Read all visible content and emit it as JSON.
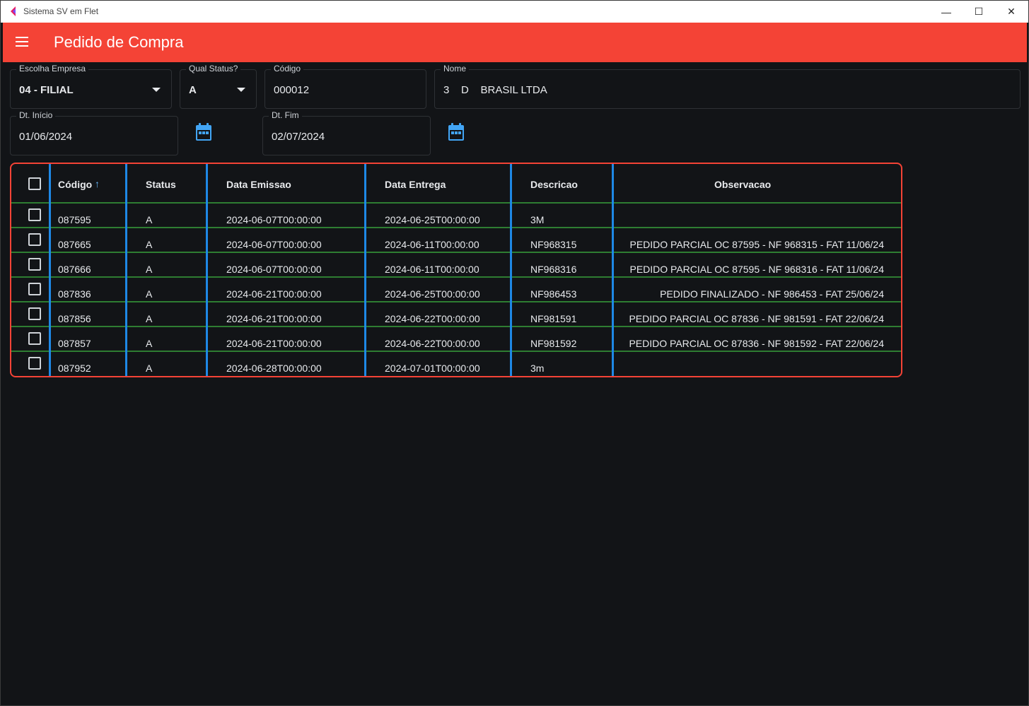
{
  "window": {
    "title": "Sistema SV em Flet",
    "minimize": "—",
    "maximize": "☐",
    "close": "✕"
  },
  "appbar": {
    "title": "Pedido de Compra",
    "icon": "menu-icon"
  },
  "filters": {
    "empresa": {
      "label": "Escolha Empresa",
      "value": "04 - FILIAL"
    },
    "status": {
      "label": "Qual Status?",
      "value": "A"
    },
    "codigo": {
      "label": "Código",
      "value": "000012"
    },
    "nome": {
      "label": "Nome",
      "value": "3    D    BRASIL LTDA"
    },
    "dt_inicio": {
      "label": "Dt. Início",
      "value": "01/06/2024"
    },
    "dt_fim": {
      "label": "Dt. Fim",
      "value": "02/07/2024"
    }
  },
  "colors": {
    "accent": "#f44336",
    "divider": "#1e88e5",
    "row_border": "#2e7d32",
    "calendar_icon": "#42a5f5"
  },
  "table": {
    "columns": [
      "Código",
      "Status",
      "Data Emissao",
      "Data Entrega",
      "Descricao",
      "Observacao"
    ],
    "sort_icon": "↑",
    "rows": [
      {
        "codigo": "087595",
        "status": "A",
        "emissao": "2024-06-07T00:00:00",
        "entrega": "2024-06-25T00:00:00",
        "descricao": "3M",
        "observacao": ""
      },
      {
        "codigo": "087665",
        "status": "A",
        "emissao": "2024-06-07T00:00:00",
        "entrega": "2024-06-11T00:00:00",
        "descricao": "NF968315",
        "observacao": "PEDIDO PARCIAL OC 87595 - NF 968315 - FAT 11/06/24"
      },
      {
        "codigo": "087666",
        "status": "A",
        "emissao": "2024-06-07T00:00:00",
        "entrega": "2024-06-11T00:00:00",
        "descricao": "NF968316",
        "observacao": "PEDIDO PARCIAL OC 87595 - NF 968316 - FAT 11/06/24"
      },
      {
        "codigo": "087836",
        "status": "A",
        "emissao": "2024-06-21T00:00:00",
        "entrega": "2024-06-25T00:00:00",
        "descricao": "NF986453",
        "observacao": "PEDIDO FINALIZADO - NF 986453 - FAT 25/06/24"
      },
      {
        "codigo": "087856",
        "status": "A",
        "emissao": "2024-06-21T00:00:00",
        "entrega": "2024-06-22T00:00:00",
        "descricao": "NF981591",
        "observacao": "PEDIDO PARCIAL OC 87836 - NF 981591 - FAT 22/06/24"
      },
      {
        "codigo": "087857",
        "status": "A",
        "emissao": "2024-06-21T00:00:00",
        "entrega": "2024-06-22T00:00:00",
        "descricao": "NF981592",
        "observacao": "PEDIDO PARCIAL OC 87836 - NF 981592 - FAT 22/06/24"
      },
      {
        "codigo": "087952",
        "status": "A",
        "emissao": "2024-06-28T00:00:00",
        "entrega": "2024-07-01T00:00:00",
        "descricao": "3m",
        "observacao": ""
      }
    ]
  }
}
